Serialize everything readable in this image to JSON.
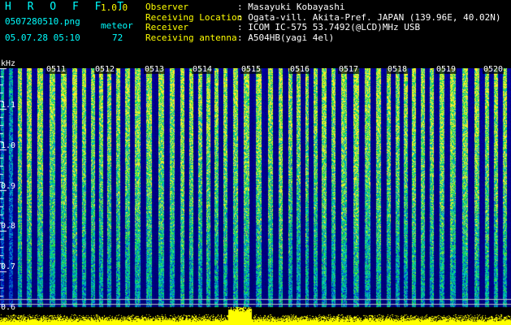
{
  "app": {
    "title": "H R O F F T",
    "version": "1.0.0"
  },
  "file": {
    "name": "0507280510.png",
    "datetime": "05.07.28 05:10"
  },
  "meteor": {
    "label": "meteor",
    "count": "72"
  },
  "info": [
    {
      "key": "Observer",
      "value": "Masayuki Kobayashi"
    },
    {
      "key": "Receiving Location",
      "value": "Ogata-vill. Akita-Pref. JAPAN (139.96E, 40.02N)"
    },
    {
      "key": "Receiver",
      "value": "ICOM IC-575 53.7492(@LCD)MHz USB"
    },
    {
      "key": "Receiving antenna",
      "value": "A504HB(yagi 4el)"
    }
  ],
  "axis": {
    "unit": "kHz",
    "y_ticks": [
      "1.1",
      "1.0",
      "0.9",
      "0.8",
      "0.7",
      "0.6"
    ],
    "x_ticks": [
      "0511",
      "0512",
      "0513",
      "0514",
      "0515",
      "0516",
      "0517",
      "0518",
      "0519",
      "0520"
    ]
  },
  "colors": {
    "title": "#00ffff",
    "key": "#ffff00",
    "spectrum_low": "#00008b",
    "spectrum_high": "#ffff00"
  }
}
